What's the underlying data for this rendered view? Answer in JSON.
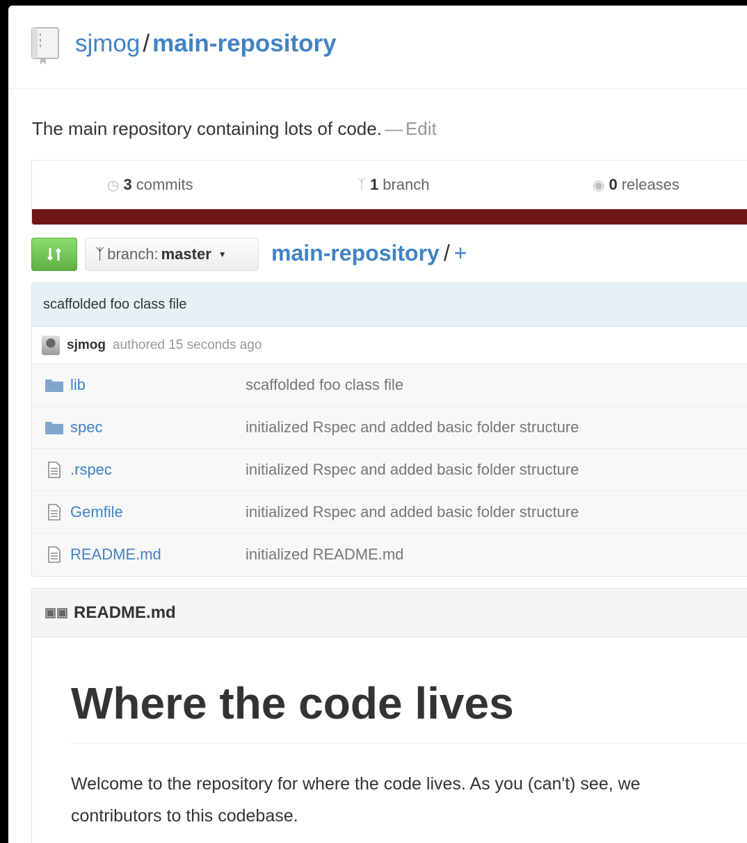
{
  "header": {
    "owner": "sjmog",
    "separator": "/",
    "repo_name": "main-repository"
  },
  "description": {
    "text": "The main repository containing lots of code.",
    "dash": "—",
    "edit_label": "Edit"
  },
  "summary": {
    "commits_count": "3",
    "commits_label": "commits",
    "branches_count": "1",
    "branches_label": "branch",
    "releases_count": "0",
    "releases_label": "releases",
    "language_color": "#701516"
  },
  "toolbar": {
    "compare_icon": "compare-icon",
    "branch_label": "branch:",
    "branch_name": "master",
    "breadcrumb_root": "main-repository",
    "breadcrumb_sep": "/",
    "breadcrumb_add": "+"
  },
  "latest_commit": {
    "message": "scaffolded foo class file",
    "author": "sjmog",
    "meta": "authored 15 seconds ago"
  },
  "files": [
    {
      "type": "folder",
      "name": "lib",
      "message": "scaffolded foo class file"
    },
    {
      "type": "folder",
      "name": "spec",
      "message": "initialized Rspec and added basic folder structure"
    },
    {
      "type": "file",
      "name": ".rspec",
      "message": "initialized Rspec and added basic folder structure"
    },
    {
      "type": "file",
      "name": "Gemfile",
      "message": "initialized Rspec and added basic folder structure"
    },
    {
      "type": "file",
      "name": "README.md",
      "message": "initialized README.md"
    }
  ],
  "readme": {
    "filename": "README.md",
    "heading": "Where the code lives",
    "paragraph_line1": "Welcome to the repository for where the code lives. As you (can't) see, we",
    "paragraph_line2": "contributors to this codebase."
  },
  "colors": {
    "link": "#4183c4",
    "accent_green": "#60b044"
  }
}
